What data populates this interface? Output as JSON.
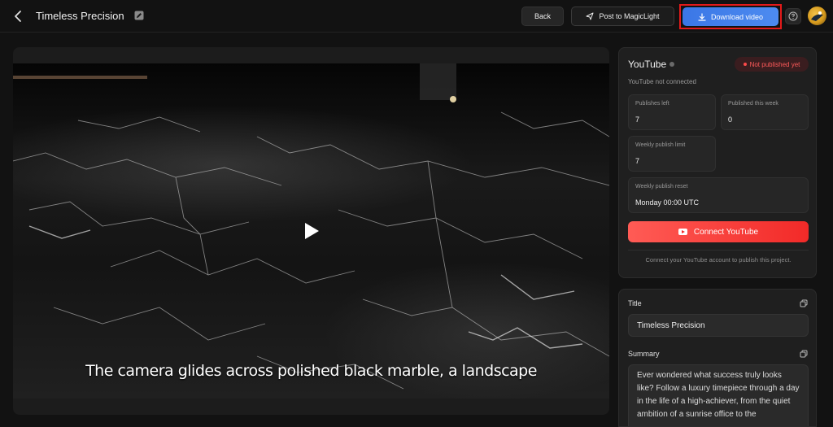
{
  "header": {
    "title": "Timeless Precision",
    "back_label": "Back",
    "post_label": "Post to MagicLight",
    "download_label": "Download video"
  },
  "video": {
    "subtitle": "The camera glides across polished black marble, a landscape"
  },
  "youtube": {
    "title": "YouTube",
    "status_badge": "Not published yet",
    "connection_status": "YouTube not connected",
    "stats": [
      {
        "label": "Publishes left",
        "value": "7"
      },
      {
        "label": "Published this week",
        "value": "0"
      },
      {
        "label": "Weekly publish limit",
        "value": "7"
      },
      {
        "label": "Weekly publish reset",
        "value": "Monday 00:00 UTC"
      }
    ],
    "connect_label": "Connect YouTube",
    "note": "Connect your YouTube account to publish this project."
  },
  "details": {
    "title_label": "Title",
    "title_value": "Timeless Precision",
    "summary_label": "Summary",
    "summary_value": "Ever wondered what success truly looks like? Follow a luxury timepiece through a day in the life of a high-achiever, from the quiet ambition of a sunrise office to the"
  },
  "colors": {
    "accent_blue": "#3b77e6",
    "youtube_red": "#f22a28",
    "highlight_border": "#e31a1a"
  }
}
